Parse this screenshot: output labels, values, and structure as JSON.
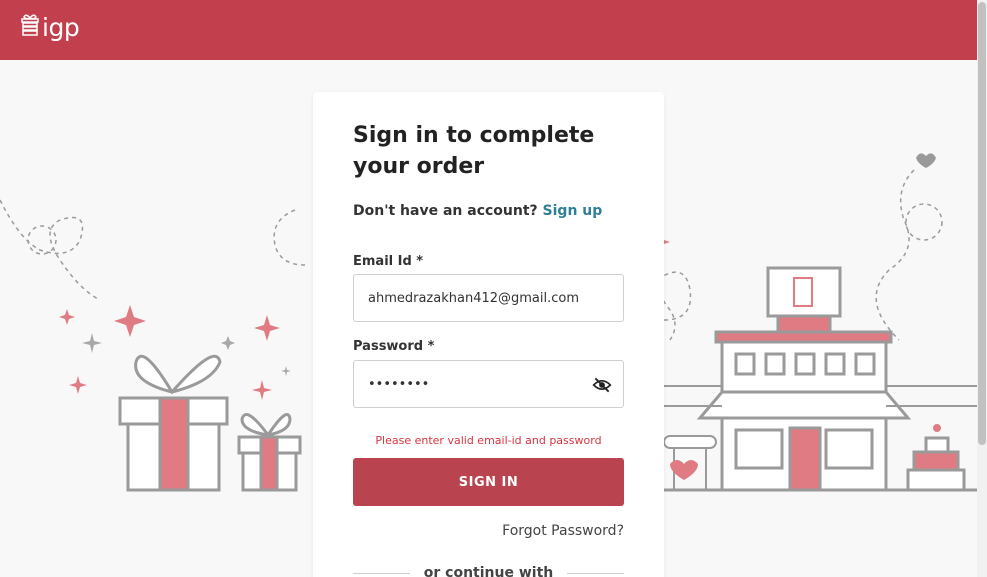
{
  "header": {
    "logo_text": "igp"
  },
  "signin": {
    "title": "Sign in to complete your order",
    "signup_prompt": "Don't have an account?",
    "signup_link": "Sign up",
    "email_label": "Email Id *",
    "email_value": "ahmedrazakhan412@gmail.com",
    "password_label": "Password *",
    "password_value": "password",
    "error_message": "Please enter valid email-id and password",
    "signin_button": "SIGN IN",
    "forgot_link": "Forgot Password?",
    "divider_text": "or continue with"
  },
  "colors": {
    "brand": "#c2404d",
    "button": "#b9434f",
    "link": "#2f7f99",
    "error": "#d9343f",
    "accent_pink": "#e07b84"
  },
  "icons": {
    "logo": "gift-icon",
    "password_toggle": "eye-off-icon"
  }
}
